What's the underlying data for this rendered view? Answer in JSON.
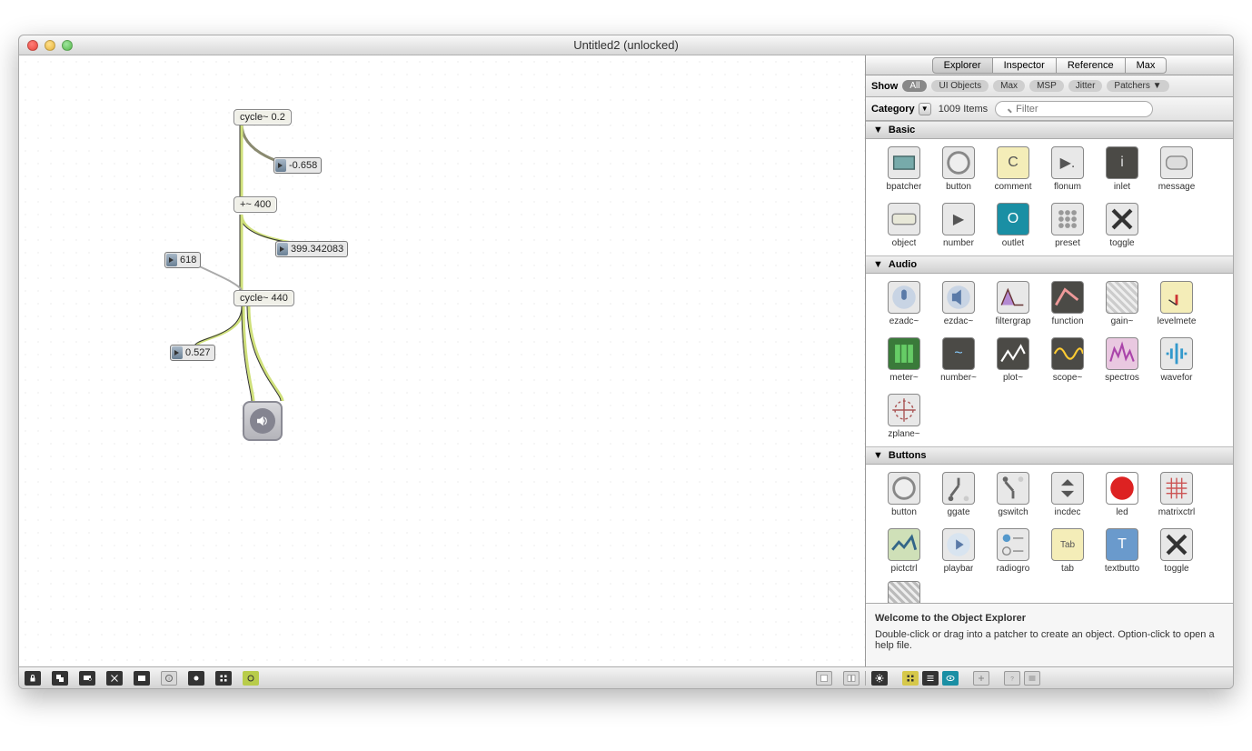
{
  "window": {
    "title": "Untitled2 (unlocked)"
  },
  "patcher": {
    "objects": {
      "cycle02": "cycle~ 0.2",
      "num_neg": "-0.658",
      "plus400": "+~ 400",
      "num_399": "399.342083",
      "num_618": "618",
      "cycle440": "cycle~ 440",
      "num_0527": "0.527"
    }
  },
  "sidebar": {
    "tabs": [
      "Explorer",
      "Inspector",
      "Reference",
      "Max"
    ],
    "show_label": "Show",
    "filters": [
      "All",
      "UI Objects",
      "Max",
      "MSP",
      "Jitter",
      "Patchers ▼"
    ],
    "category_label": "Category",
    "items_count": "1009 Items",
    "search_placeholder": "Filter",
    "sections": {
      "basic": {
        "title": "Basic",
        "items": [
          "bpatcher",
          "button",
          "comment",
          "flonum",
          "inlet",
          "message",
          "object",
          "number",
          "outlet",
          "preset",
          "toggle"
        ]
      },
      "audio": {
        "title": "Audio",
        "items": [
          "ezadc~",
          "ezdac~",
          "filtergrap",
          "function",
          "gain~",
          "levelmete",
          "meter~",
          "number~",
          "plot~",
          "scope~",
          "spectros",
          "wavefor",
          "zplane~"
        ]
      },
      "buttons": {
        "title": "Buttons",
        "items": [
          "button",
          "ggate",
          "gswitch",
          "incdec",
          "led",
          "matrixctrl",
          "pictctrl",
          "playbar",
          "radiogro",
          "tab",
          "textbutto",
          "toggle"
        ]
      }
    },
    "info_title": "Welcome to the Object Explorer",
    "info_text": "Double-click or drag into a patcher to create an object. Option-click to open a help file."
  }
}
